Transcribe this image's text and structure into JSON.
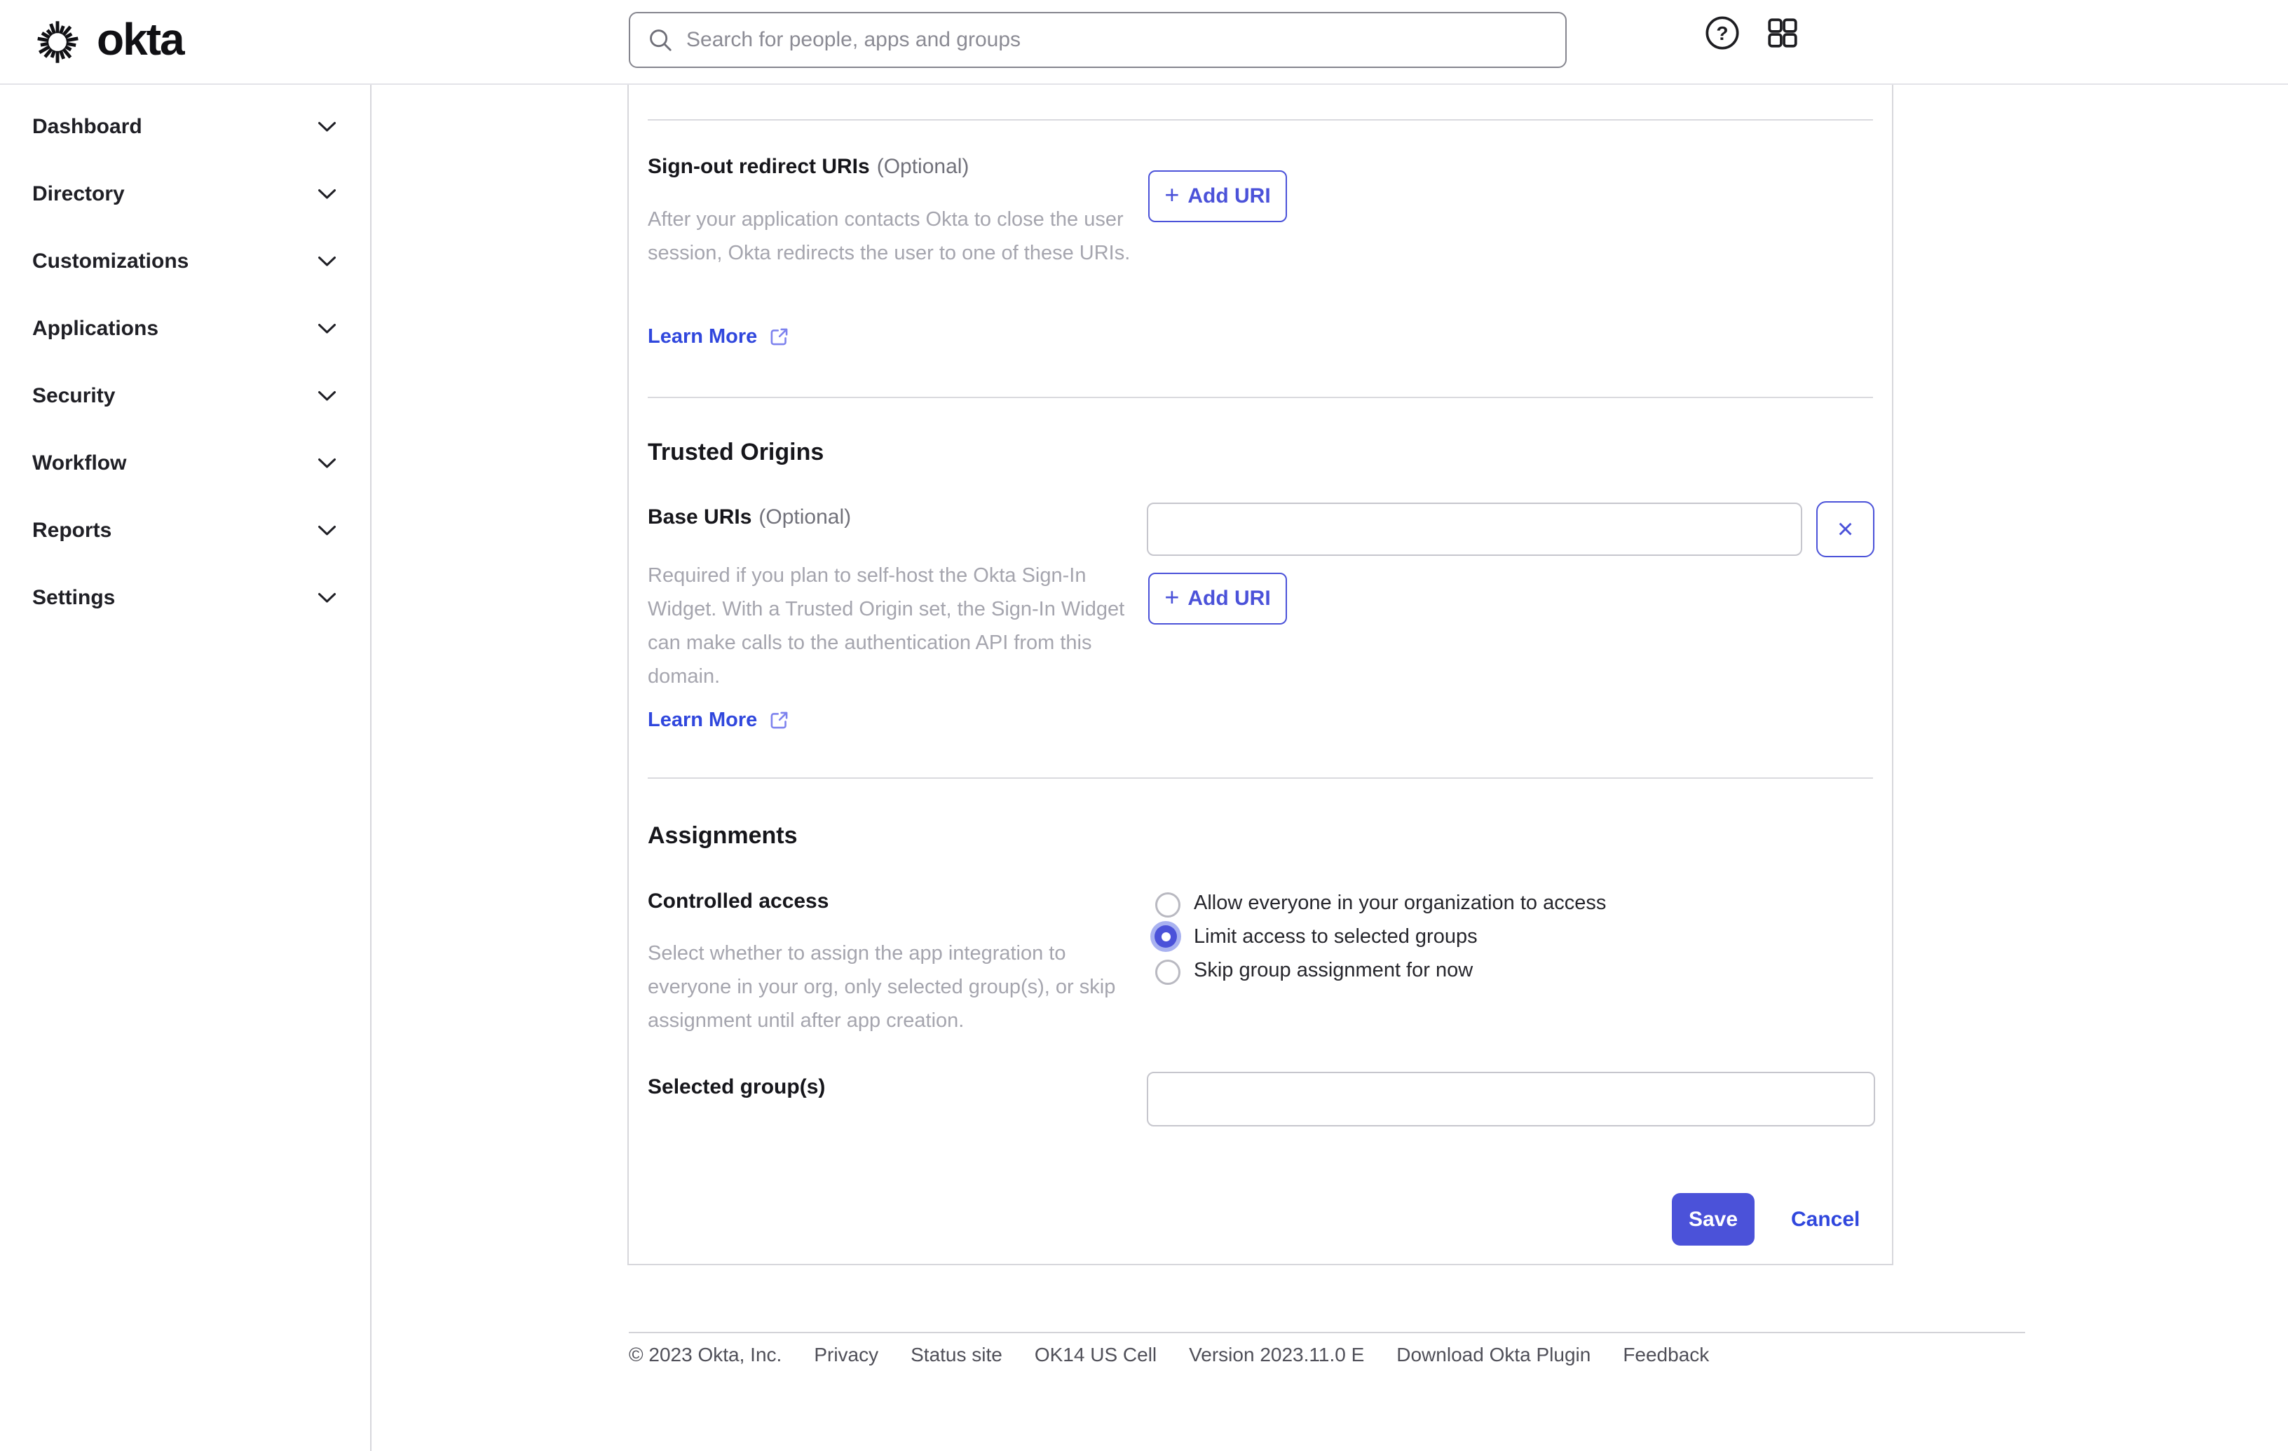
{
  "header": {
    "brand": "okta",
    "search_placeholder": "Search for people, apps and groups"
  },
  "sidebar": {
    "items": [
      {
        "label": "Dashboard"
      },
      {
        "label": "Directory"
      },
      {
        "label": "Customizations"
      },
      {
        "label": "Applications"
      },
      {
        "label": "Security"
      },
      {
        "label": "Workflow"
      },
      {
        "label": "Reports"
      },
      {
        "label": "Settings"
      }
    ]
  },
  "content": {
    "signout": {
      "label": "Sign-out redirect URIs",
      "optional": "(Optional)",
      "description": "After your application contacts Okta to close the user session, Okta redirects the user to one of these URIs.",
      "learn_more": "Learn More",
      "add_uri": "Add URI"
    },
    "trusted_origins": {
      "heading": "Trusted Origins",
      "base_uris_label": "Base URIs",
      "optional": "(Optional)",
      "value": "",
      "description": "Required if you plan to self-host the Okta Sign-In Widget. With a Trusted Origin set, the Sign-In Widget can make calls to the authentication API from this domain.",
      "learn_more": "Learn More",
      "add_uri": "Add URI"
    },
    "assignments": {
      "heading": "Assignments",
      "controlled_access": {
        "label": "Controlled access",
        "description": "Select whether to assign the app integration to everyone in your org, only selected group(s), or skip assignment until after app creation.",
        "options": [
          {
            "label": "Allow everyone in your organization to access",
            "selected": false
          },
          {
            "label": "Limit access to selected groups",
            "selected": true
          },
          {
            "label": "Skip group assignment for now",
            "selected": false
          }
        ]
      },
      "selected_groups": {
        "label": "Selected group(s)",
        "value": ""
      }
    },
    "actions": {
      "save": "Save",
      "cancel": "Cancel"
    }
  },
  "footer": {
    "items": [
      "© 2023 Okta, Inc.",
      "Privacy",
      "Status site",
      "OK14 US Cell",
      "Version 2023.11.0 E",
      "Download Okta Plugin",
      "Feedback"
    ]
  },
  "icons": {
    "plus": "+",
    "close": "×",
    "search": "search-icon",
    "help": "help-icon",
    "apps_grid": "apps-grid-icon",
    "chevron": "chevron-down-icon",
    "external_link": "external-link-icon",
    "logo": "okta-aura-icon"
  },
  "colors": {
    "accent": "#4b52d9",
    "accent_halo": "#a9b2f0",
    "link": "#3047dd",
    "text": "#1d1d21",
    "muted_text": "#a5a5ae",
    "footer_text": "#4f4f58",
    "border": "#d7d7dc",
    "input_border": "#c6c6cd"
  }
}
